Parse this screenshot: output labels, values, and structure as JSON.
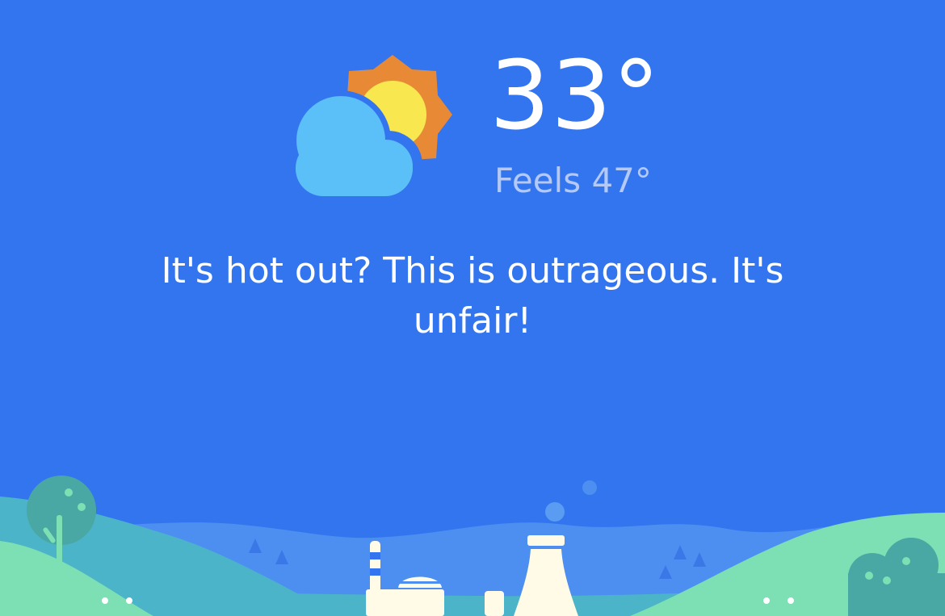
{
  "weather": {
    "condition_icon": "partly-cloudy-sun-icon",
    "temperature": "33°",
    "feels_like": "Feels 47°",
    "message": "It's hot out? This is outrageous. It's unfair!"
  },
  "colors": {
    "background": "#3375ef",
    "cloud": "#5bbff8",
    "sun": "#f8e74f",
    "sun_rays": "#e88a35",
    "feels_text": "#b4c9f5",
    "hill_light": "#7ce0b4",
    "hill_teal": "#4cb4c8",
    "hill_blue": "#4c8ff0",
    "building": "#fffbe6"
  },
  "illustration": {
    "name": "city-landscape-illustration"
  }
}
